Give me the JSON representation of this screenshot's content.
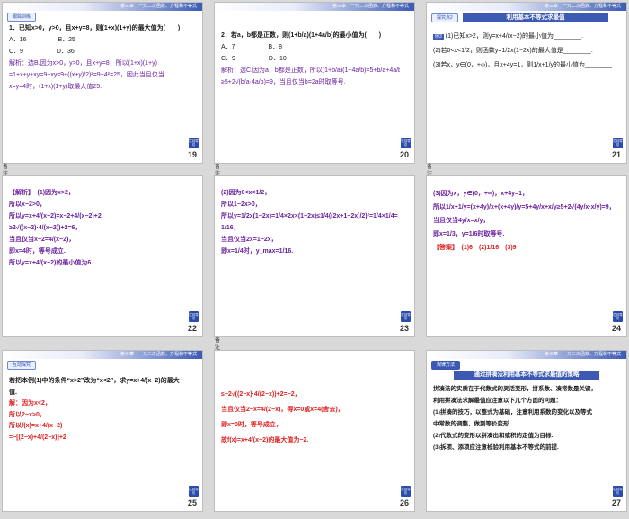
{
  "slides": [
    {
      "page": "19",
      "header": "第三章　一元二次函数、方程和不等式",
      "tag": "跟踪训练",
      "lines": [
        "1．已知x>0，y>0，且x+y=8，则(1+x)(1+y)的最大值为(　　)",
        "A．16　　　　　B．25",
        "C．9　　　　　 D．36",
        "解析：选B.因为x>0，y>0，且x+y=8，所以(1+x)(1+y)",
        "=1+x+y+xy=9+xy≤9+((x+y)/2)²=9+4²=25，因此当且仅当",
        "x=y=4时，(1+x)(1+y)取最大值25."
      ]
    },
    {
      "page": "20",
      "header": "第三章　一元二次函数、方程和不等式",
      "lines": [
        "2．若a，b都是正数，则(1+b/a)(1+4a/b)的最小值为(　　)",
        "A．7　　　　　 B．8",
        "C．9　　　　　 D．10",
        "解析：选C.因为a，b都是正数，所以(1+b/a)(1+4a/b)=5+b/a+4a/b",
        "≥5+2√(b/a·4a/b)=9，当且仅当b=2a时取等号."
      ]
    },
    {
      "page": "21",
      "header": "第三章　一元二次函数、方程和不等式",
      "tag": "探究点2",
      "title": "利用基本不等式求最值",
      "example": "例3",
      "lines": [
        "(1)已知x>2，则y=x+4/(x−2)的最小值为________.",
        "(2)若0<x<1/2，则函数y=1/2x(1−2x)的最大值是________.",
        "(3)若x，y∈(0，+∞)，且x+4y=1，则1/x+1/y的最小值为________."
      ]
    },
    {
      "page": "22",
      "lines": [
        "【解析】　(1)因为x>2，",
        "所以x−2>0，",
        "所以y=x+4/(x−2)=x−2+4/(x−2)+2",
        "≥2√((x−2)·4/(x−2))+2=6，",
        "当且仅当x−2=4/(x−2)，",
        "即x=4时，等号成立.",
        "所以y=x+4/(x−2)的最小值为6."
      ]
    },
    {
      "page": "23",
      "lines": [
        "(2)因为0<x<1/2，",
        "所以1−2x>0，",
        "所以y=1/2x(1−2x)=1/4×2x×(1−2x)≤1/4((2x+1−2x)/2)²=1/4×1/4=",
        "1/16，",
        "当且仅当2x=1−2x，",
        "即x=1/4时，y_max=1/16."
      ]
    },
    {
      "page": "24",
      "lines": [
        "(3)因为x，y∈(0，+∞)，x+4y=1，",
        "所以1/x+1/y=(x+4y)/x+(x+4y)/y=5+4y/x+x/y≥5+2√(4y/x·x/y)=9，",
        "当且仅当4y/x=x/y，",
        "即x=1/3，y=1/6时取等号.",
        "【答案】　(1)6　(2)1/16　(3)9"
      ]
    },
    {
      "page": "25",
      "header": "第三章　一元二次函数、方程和不等式",
      "tag": "互动探究",
      "lines": [
        "若把本例(1)中的条件“x>2”改为“x<2”，求y=x+4/(x−2)的最大",
        "值.",
        "解：因为x<2，",
        "所以2−x>0，",
        "所以f(x)=x+4/(x−2)",
        "=−[(2−x)+4/(2−x)]+2"
      ]
    },
    {
      "page": "26",
      "lines": [
        "≤−2√((2−x)·4/(2−x))+2=−2，",
        "当且仅当2−x=4/(2−x)，得x=0或x=4(舍去)，",
        "即x=0时，等号成立，",
        "故f(x)=x+4/(x−2)的最大值为−2."
      ]
    },
    {
      "page": "27",
      "header": "第三章　一元二次函数、方程和不等式",
      "tag": "规律方法",
      "title": "通过拼凑法利用基本不等式求最值的策略",
      "lines": [
        "拼凑法的实质在于代数式的灵活变形，拼系数、凑常数是关键，",
        "利用拼凑法求解最值应注意以下几个方面的问题：",
        "(1)拼凑的技巧，以整式为基础，注意利用系数的变化以及等式",
        "中常数的调整，做到等价变形.",
        "(2)代数式的变形以拼凑出和或积的定值为目标.",
        "(3)拆项、添项应注意检验利用基本不等式的前提."
      ]
    }
  ],
  "back_button": "栏目导引",
  "note_icon": "备注"
}
